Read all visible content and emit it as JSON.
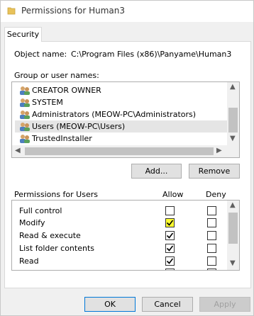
{
  "window": {
    "title": "Permissions for Human3"
  },
  "tabs": [
    {
      "label": "Security"
    }
  ],
  "object": {
    "label": "Object name:",
    "value": "C:\\Program Files (x86)\\Panyame\\Human3"
  },
  "group": {
    "label": "Group or user names:",
    "items": [
      {
        "name": "CREATOR OWNER",
        "selected": false
      },
      {
        "name": "SYSTEM",
        "selected": false
      },
      {
        "name": "Administrators (MEOW-PC\\Administrators)",
        "selected": false
      },
      {
        "name": "Users (MEOW-PC\\Users)",
        "selected": true
      },
      {
        "name": "TrustedInstaller",
        "selected": false
      }
    ]
  },
  "buttons": {
    "add": "Add...",
    "remove": "Remove",
    "ok": "OK",
    "cancel": "Cancel",
    "apply": "Apply"
  },
  "permissions": {
    "title": "Permissions for Users",
    "allow_header": "Allow",
    "deny_header": "Deny",
    "rows": [
      {
        "name": "Full control",
        "allow": false,
        "deny": false
      },
      {
        "name": "Modify",
        "allow": true,
        "deny": false,
        "highlighted": true
      },
      {
        "name": "Read & execute",
        "allow": true,
        "deny": false
      },
      {
        "name": "List folder contents",
        "allow": true,
        "deny": false
      },
      {
        "name": "Read",
        "allow": true,
        "deny": false
      }
    ]
  },
  "colors": {
    "highlight": "#ffff30",
    "selection": "#e5e5e5",
    "accent": "#0078d7"
  }
}
